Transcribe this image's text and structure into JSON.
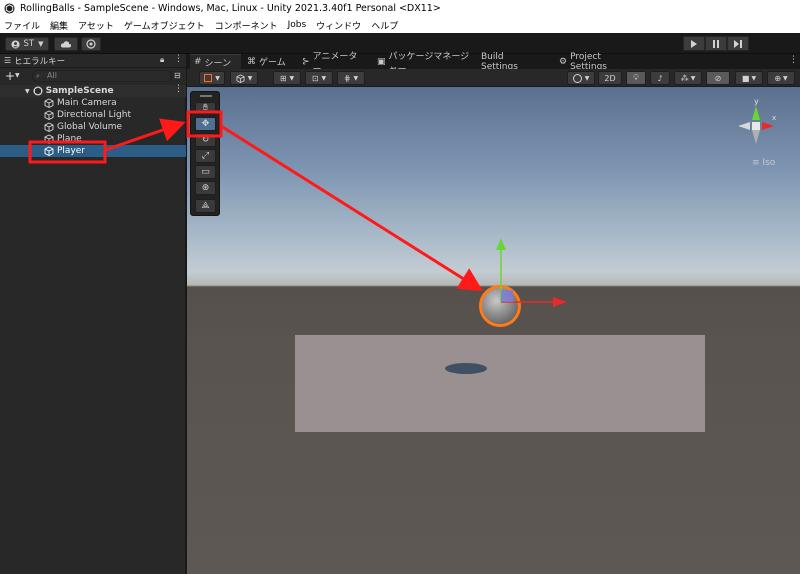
{
  "window": {
    "title": "RollingBalls - SampleScene - Windows, Mac, Linux - Unity 2021.3.40f1 Personal <DX11>"
  },
  "menu": [
    "ファイル",
    "編集",
    "アセット",
    "ゲームオブジェクト",
    "コンポーネント",
    "Jobs",
    "ウィンドウ",
    "ヘルプ"
  ],
  "toolbar": {
    "account_label": "ST"
  },
  "hierarchy": {
    "tab_label": "ヒエラルキー",
    "search_placeholder": "All",
    "scene_name": "SampleScene",
    "items": [
      "Main Camera",
      "Directional Light",
      "Global Volume",
      "Plane",
      "Player"
    ],
    "selected_item": "Player"
  },
  "tabs": [
    "シーン",
    "ゲーム",
    "アニメーター",
    "パッケージマネージャー",
    "Build Settings",
    "Project Settings"
  ],
  "scene_toolbar": {
    "mode_2d": "2D"
  },
  "gizmo": {
    "y_label": "y",
    "x_label": "x",
    "projection_label": "Iso"
  },
  "colors": {
    "highlight_red": "#ff1a1a",
    "selection_blue": "#2c5d87",
    "select_outline": "#ff7a18"
  }
}
